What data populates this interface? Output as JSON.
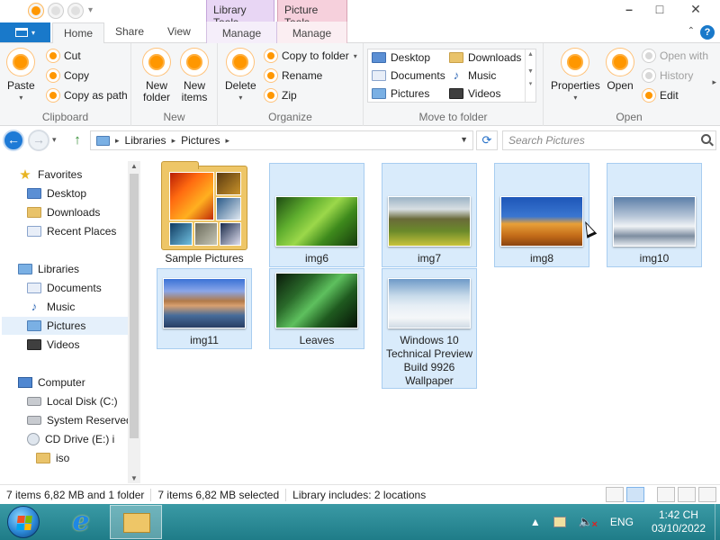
{
  "window": {
    "context_tabs": [
      "Library Tools",
      "Picture Tools"
    ],
    "controls": {
      "minimize": "–",
      "maximize": "□",
      "close": "✕"
    }
  },
  "ribbon_tabs": {
    "file": "",
    "home": "Home",
    "share": "Share",
    "view": "View",
    "manage_library": "Manage",
    "manage_picture": "Manage"
  },
  "ribbon": {
    "clipboard": {
      "label": "Clipboard",
      "paste": "Paste",
      "cut": "Cut",
      "copy": "Copy",
      "copy_as_path": "Copy as path"
    },
    "new": {
      "label": "New",
      "new_folder": "New folder",
      "new_items": "New items"
    },
    "organize": {
      "label": "Organize",
      "delete": "Delete",
      "copy_to_folder": "Copy to folder",
      "rename": "Rename",
      "zip": "Zip"
    },
    "move_to_folder": {
      "label": "Move to folder",
      "items": [
        "Desktop",
        "Downloads",
        "Documents",
        "Music",
        "Pictures",
        "Videos"
      ]
    },
    "open": {
      "label": "Open",
      "properties": "Properties",
      "open": "Open",
      "open_with": "Open with",
      "history": "History",
      "edit": "Edit"
    }
  },
  "address": {
    "crumbs": [
      "Libraries",
      "Pictures"
    ],
    "search_placeholder": "Search Pictures"
  },
  "nav": {
    "favorites": "Favorites",
    "desktop": "Desktop",
    "downloads": "Downloads",
    "recent_places": "Recent Places",
    "libraries": "Libraries",
    "documents": "Documents",
    "music": "Music",
    "pictures": "Pictures",
    "videos": "Videos",
    "computer": "Computer",
    "local_disk": "Local Disk (C:)",
    "system_reserved": "System Reserved",
    "cd_drive": "CD Drive (E:) i",
    "iso": "iso"
  },
  "files": [
    {
      "name": "Sample Pictures",
      "type": "folder",
      "selected": false
    },
    {
      "name": "img6",
      "type": "image",
      "selected": true
    },
    {
      "name": "img7",
      "type": "image",
      "selected": true
    },
    {
      "name": "img8",
      "type": "image",
      "selected": true
    },
    {
      "name": "img10",
      "type": "image",
      "selected": true
    },
    {
      "name": "img11",
      "type": "image",
      "selected": true
    },
    {
      "name": "Leaves",
      "type": "image",
      "selected": true
    },
    {
      "name": "Windows 10 Technical Preview Build 9926 Wallpaper",
      "type": "image",
      "selected": true
    }
  ],
  "status": {
    "items_total": "7 items 6,82 MB and 1 folder",
    "items_selected": "7 items 6,82 MB selected",
    "library_includes": "Library includes:  2 locations"
  },
  "taskbar": {
    "language": "ENG",
    "time": "1:42 CH",
    "date": "03/10/2022"
  },
  "colors": {
    "accent": "#1979ca",
    "selection": "#d9ebfb",
    "taskbar": "#1f7c88"
  }
}
